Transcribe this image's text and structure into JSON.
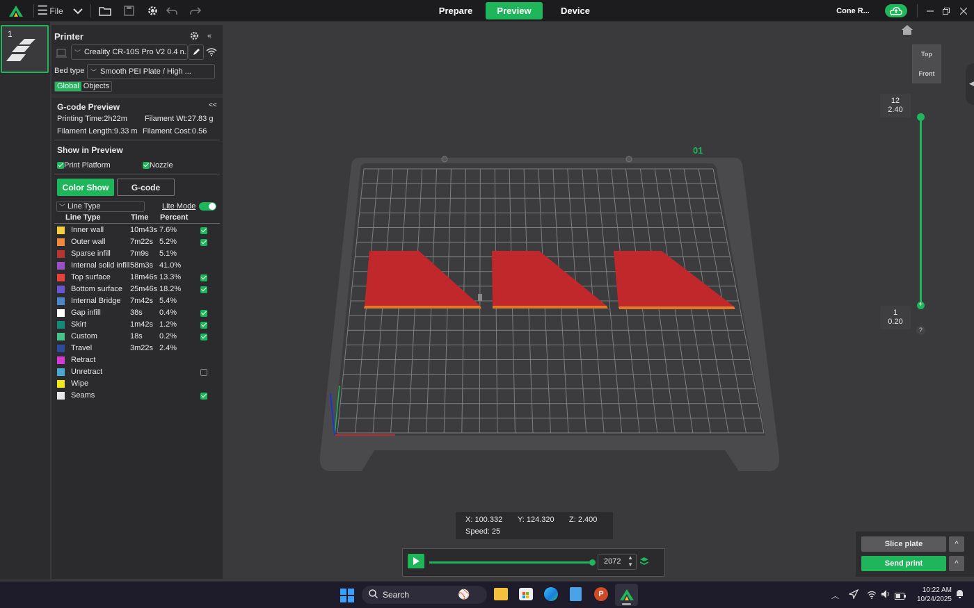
{
  "topbar": {
    "file_label": "File",
    "tabs": [
      "Prepare",
      "Preview",
      "Device"
    ],
    "active_tab": "Preview",
    "project_name": "Cone R..."
  },
  "thumbs": {
    "plate_number": "1"
  },
  "printer": {
    "title": "Printer",
    "printer_name": "Creality CR-10S Pro V2 0.4 n...",
    "bed_type_label": "Bed type",
    "bed_type_value": "Smooth PEI Plate / High ...",
    "toggle_global": "Global",
    "toggle_objects": "Objects"
  },
  "gcode": {
    "title": "G-code Preview",
    "collapse": "<<",
    "printing_time": "Printing Time:2h22m",
    "filament_wt": "Filament Wt:27.83 g",
    "filament_length": "Filament Length:9.33 m",
    "filament_cost": "Filament Cost:0.56"
  },
  "show": {
    "title": "Show in Preview",
    "print_platform": "Print Platform",
    "nozzle": "Nozzle",
    "color_show": "Color Show",
    "gcode_btn": "G-code"
  },
  "linetype": {
    "dropdown": "Line Type",
    "lite_mode": "Lite Mode",
    "headers": [
      "Line Type",
      "Time",
      "Percent"
    ],
    "rows": [
      {
        "name": "Inner wall",
        "time": "10m43s",
        "percent": "7.6%",
        "color": "#f5d03b",
        "check": "on"
      },
      {
        "name": "Outer wall",
        "time": "7m22s",
        "percent": "5.2%",
        "color": "#f08a3a",
        "check": "on"
      },
      {
        "name": "Sparse infill",
        "time": "7m9s",
        "percent": "5.1%",
        "color": "#b8342e",
        "check": "none"
      },
      {
        "name": "Internal solid infill",
        "time": "58m3s",
        "percent": "41.0%",
        "color": "#9a4fc9",
        "check": "none"
      },
      {
        "name": "Top surface",
        "time": "18m46s",
        "percent": "13.3%",
        "color": "#e8413a",
        "check": "on"
      },
      {
        "name": "Bottom surface",
        "time": "25m46s",
        "percent": "18.2%",
        "color": "#6a55d0",
        "check": "on"
      },
      {
        "name": "Internal Bridge",
        "time": "7m42s",
        "percent": "5.4%",
        "color": "#4a86c8",
        "check": "none"
      },
      {
        "name": "Gap infill",
        "time": "38s",
        "percent": "0.4%",
        "color": "#ffffff",
        "check": "on"
      },
      {
        "name": "Skirt",
        "time": "1m42s",
        "percent": "1.2%",
        "color": "#138a78",
        "check": "on"
      },
      {
        "name": "Custom",
        "time": "18s",
        "percent": "0.2%",
        "color": "#43c58a",
        "check": "on"
      },
      {
        "name": "Travel",
        "time": "3m22s",
        "percent": "2.4%",
        "color": "#2f4a9a",
        "check": "none"
      },
      {
        "name": "Retract",
        "time": "",
        "percent": "",
        "color": "#d43ad4",
        "check": "none"
      },
      {
        "name": "Unretract",
        "time": "",
        "percent": "",
        "color": "#4aa8d0",
        "check": "off"
      },
      {
        "name": "Wipe",
        "time": "",
        "percent": "",
        "color": "#f0e81a",
        "check": "none"
      },
      {
        "name": "Seams",
        "time": "",
        "percent": "",
        "color": "#e8e8e8",
        "check": "on"
      }
    ]
  },
  "viewport": {
    "view_top": "Top",
    "view_front": "Front",
    "plate_label": "01",
    "layer_top_num": "12",
    "layer_top_height": "2.40",
    "layer_bottom_num": "1",
    "layer_bottom_height": "0.20",
    "help": "?",
    "coord_x": "X: 100.332",
    "coord_y": "Y: 124.320",
    "coord_z": "Z: 2.400",
    "speed": "Speed: 25",
    "move_value": "2072",
    "slice_plate": "Slice plate",
    "send_print": "Send print",
    "caret": "^"
  },
  "taskbar": {
    "search": "Search",
    "time": "10:22 AM",
    "date": "10/24/2025"
  }
}
